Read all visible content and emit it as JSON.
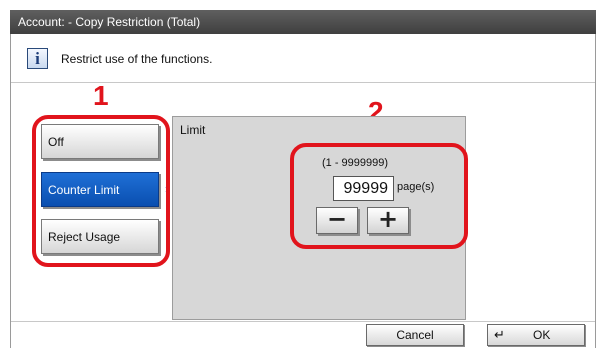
{
  "window": {
    "title": "Account:  - Copy Restriction (Total)"
  },
  "info": {
    "icon": "info-icon",
    "icon_glyph": "i",
    "message": "Restrict use of the functions."
  },
  "annotations": {
    "marker_1": "1",
    "marker_2": "2",
    "circle_color": "#e1141c"
  },
  "modes": [
    {
      "label": "Off",
      "selected": false
    },
    {
      "label": "Counter Limit",
      "selected": true
    },
    {
      "label": "Reject Usage",
      "selected": false
    }
  ],
  "limit": {
    "title": "Limit",
    "range": "(1 - 9999999)",
    "value": "99999",
    "unit": "page(s)",
    "decrement_icon": "minus-icon",
    "decrement_glyph": "−",
    "increment_icon": "plus-icon",
    "increment_glyph": "+"
  },
  "footer": {
    "cancel_label": "Cancel",
    "ok_label": "OK",
    "ok_icon": "enter-icon",
    "ok_glyph": "↵"
  },
  "colors": {
    "title_bar": "#4a4a4a",
    "selected_button": "#1565c8",
    "panel_gray": "#d7d7d7"
  }
}
